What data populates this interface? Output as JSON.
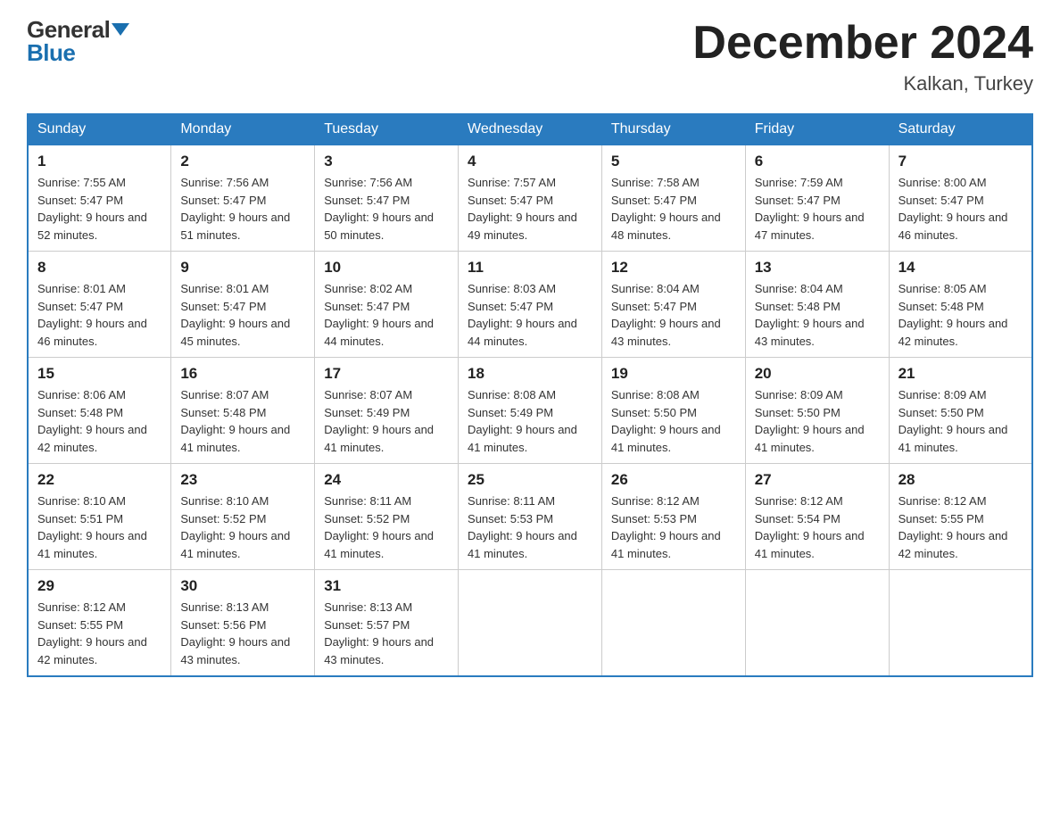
{
  "header": {
    "logo_general": "General",
    "logo_blue": "Blue",
    "month_title": "December 2024",
    "location": "Kalkan, Turkey"
  },
  "days_of_week": [
    "Sunday",
    "Monday",
    "Tuesday",
    "Wednesday",
    "Thursday",
    "Friday",
    "Saturday"
  ],
  "weeks": [
    [
      {
        "day": "1",
        "sunrise": "7:55 AM",
        "sunset": "5:47 PM",
        "daylight": "9 hours and 52 minutes."
      },
      {
        "day": "2",
        "sunrise": "7:56 AM",
        "sunset": "5:47 PM",
        "daylight": "9 hours and 51 minutes."
      },
      {
        "day": "3",
        "sunrise": "7:56 AM",
        "sunset": "5:47 PM",
        "daylight": "9 hours and 50 minutes."
      },
      {
        "day": "4",
        "sunrise": "7:57 AM",
        "sunset": "5:47 PM",
        "daylight": "9 hours and 49 minutes."
      },
      {
        "day": "5",
        "sunrise": "7:58 AM",
        "sunset": "5:47 PM",
        "daylight": "9 hours and 48 minutes."
      },
      {
        "day": "6",
        "sunrise": "7:59 AM",
        "sunset": "5:47 PM",
        "daylight": "9 hours and 47 minutes."
      },
      {
        "day": "7",
        "sunrise": "8:00 AM",
        "sunset": "5:47 PM",
        "daylight": "9 hours and 46 minutes."
      }
    ],
    [
      {
        "day": "8",
        "sunrise": "8:01 AM",
        "sunset": "5:47 PM",
        "daylight": "9 hours and 46 minutes."
      },
      {
        "day": "9",
        "sunrise": "8:01 AM",
        "sunset": "5:47 PM",
        "daylight": "9 hours and 45 minutes."
      },
      {
        "day": "10",
        "sunrise": "8:02 AM",
        "sunset": "5:47 PM",
        "daylight": "9 hours and 44 minutes."
      },
      {
        "day": "11",
        "sunrise": "8:03 AM",
        "sunset": "5:47 PM",
        "daylight": "9 hours and 44 minutes."
      },
      {
        "day": "12",
        "sunrise": "8:04 AM",
        "sunset": "5:47 PM",
        "daylight": "9 hours and 43 minutes."
      },
      {
        "day": "13",
        "sunrise": "8:04 AM",
        "sunset": "5:48 PM",
        "daylight": "9 hours and 43 minutes."
      },
      {
        "day": "14",
        "sunrise": "8:05 AM",
        "sunset": "5:48 PM",
        "daylight": "9 hours and 42 minutes."
      }
    ],
    [
      {
        "day": "15",
        "sunrise": "8:06 AM",
        "sunset": "5:48 PM",
        "daylight": "9 hours and 42 minutes."
      },
      {
        "day": "16",
        "sunrise": "8:07 AM",
        "sunset": "5:48 PM",
        "daylight": "9 hours and 41 minutes."
      },
      {
        "day": "17",
        "sunrise": "8:07 AM",
        "sunset": "5:49 PM",
        "daylight": "9 hours and 41 minutes."
      },
      {
        "day": "18",
        "sunrise": "8:08 AM",
        "sunset": "5:49 PM",
        "daylight": "9 hours and 41 minutes."
      },
      {
        "day": "19",
        "sunrise": "8:08 AM",
        "sunset": "5:50 PM",
        "daylight": "9 hours and 41 minutes."
      },
      {
        "day": "20",
        "sunrise": "8:09 AM",
        "sunset": "5:50 PM",
        "daylight": "9 hours and 41 minutes."
      },
      {
        "day": "21",
        "sunrise": "8:09 AM",
        "sunset": "5:50 PM",
        "daylight": "9 hours and 41 minutes."
      }
    ],
    [
      {
        "day": "22",
        "sunrise": "8:10 AM",
        "sunset": "5:51 PM",
        "daylight": "9 hours and 41 minutes."
      },
      {
        "day": "23",
        "sunrise": "8:10 AM",
        "sunset": "5:52 PM",
        "daylight": "9 hours and 41 minutes."
      },
      {
        "day": "24",
        "sunrise": "8:11 AM",
        "sunset": "5:52 PM",
        "daylight": "9 hours and 41 minutes."
      },
      {
        "day": "25",
        "sunrise": "8:11 AM",
        "sunset": "5:53 PM",
        "daylight": "9 hours and 41 minutes."
      },
      {
        "day": "26",
        "sunrise": "8:12 AM",
        "sunset": "5:53 PM",
        "daylight": "9 hours and 41 minutes."
      },
      {
        "day": "27",
        "sunrise": "8:12 AM",
        "sunset": "5:54 PM",
        "daylight": "9 hours and 41 minutes."
      },
      {
        "day": "28",
        "sunrise": "8:12 AM",
        "sunset": "5:55 PM",
        "daylight": "9 hours and 42 minutes."
      }
    ],
    [
      {
        "day": "29",
        "sunrise": "8:12 AM",
        "sunset": "5:55 PM",
        "daylight": "9 hours and 42 minutes."
      },
      {
        "day": "30",
        "sunrise": "8:13 AM",
        "sunset": "5:56 PM",
        "daylight": "9 hours and 43 minutes."
      },
      {
        "day": "31",
        "sunrise": "8:13 AM",
        "sunset": "5:57 PM",
        "daylight": "9 hours and 43 minutes."
      },
      null,
      null,
      null,
      null
    ]
  ]
}
